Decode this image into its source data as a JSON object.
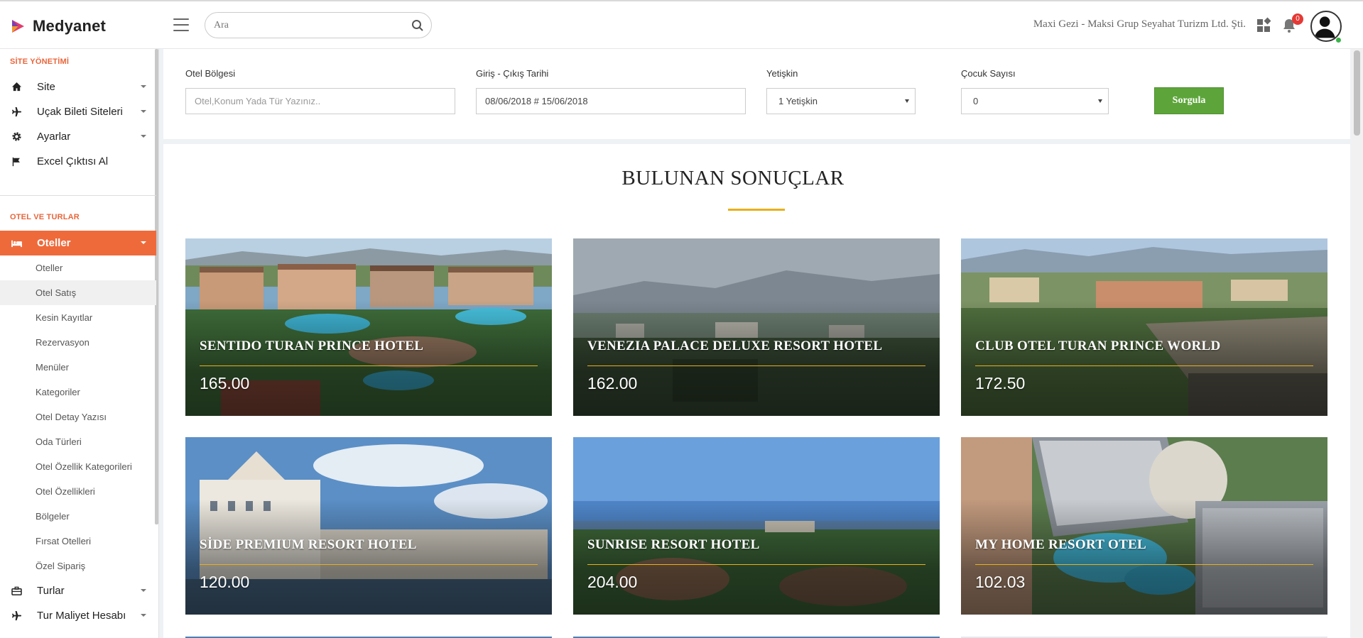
{
  "brand": {
    "name": "Medyanet"
  },
  "search": {
    "placeholder": "Ara"
  },
  "header": {
    "company": "Maxi Gezi - Maksi Grup Seyahat Turizm Ltd. Şti.",
    "notification_count": "0"
  },
  "sidebar": {
    "section1": "SİTE YÖNETİMİ",
    "items1": [
      {
        "label": "Site",
        "icon": "home-icon"
      },
      {
        "label": "Uçak Bileti Siteleri",
        "icon": "plane-icon"
      },
      {
        "label": "Ayarlar",
        "icon": "gear-icon"
      },
      {
        "label": "Excel Çıktısı Al",
        "icon": "flag-icon"
      }
    ],
    "section2": "OTEL VE TURLAR",
    "active": {
      "label": "Oteller",
      "icon": "bed-icon"
    },
    "subitems": [
      "Oteller",
      "Otel Satış",
      "Kesin Kayıtlar",
      "Rezervasyon",
      "Menüler",
      "Kategoriler",
      "Otel Detay Yazısı",
      "Oda Türleri",
      "Otel Özellik Kategorileri",
      "Otel Özellikleri",
      "Bölgeler",
      "Fırsat Otelleri",
      "Özel Sipariş"
    ],
    "items2": [
      {
        "label": "Turlar",
        "icon": "briefcase-icon"
      },
      {
        "label": "Tur Maliyet Hesabı",
        "icon": "plane-icon"
      }
    ]
  },
  "filter": {
    "region_label": "Otel Bölgesi",
    "region_placeholder": "Otel,Konum Yada Tür Yazınız..",
    "date_label": "Giriş - Çıkış Tarihi",
    "date_value": "08/06/2018 # 15/06/2018",
    "adult_label": "Yetişkin",
    "adult_value": "1 Yetişkin",
    "child_label": "Çocuk Sayısı",
    "child_value": "0",
    "submit": "Sorgula"
  },
  "results": {
    "title": "BULUNAN SONUÇLAR",
    "hotels": [
      {
        "name": "SENTIDO TURAN PRINCE HOTEL",
        "price": "165.00"
      },
      {
        "name": "VENEZIA PALACE DELUXE RESORT HOTEL",
        "price": "162.00"
      },
      {
        "name": "CLUB OTEL TURAN PRINCE WORLD",
        "price": "172.50"
      },
      {
        "name": "SİDE PREMIUM RESORT HOTEL",
        "price": "120.00"
      },
      {
        "name": "SUNRISE RESORT HOTEL",
        "price": "204.00"
      },
      {
        "name": "MY HOME RESORT OTEL",
        "price": "102.03"
      }
    ]
  },
  "colors": {
    "accent": "#ef6a3b",
    "gold": "#e7b01b",
    "submit": "#5da53a"
  }
}
